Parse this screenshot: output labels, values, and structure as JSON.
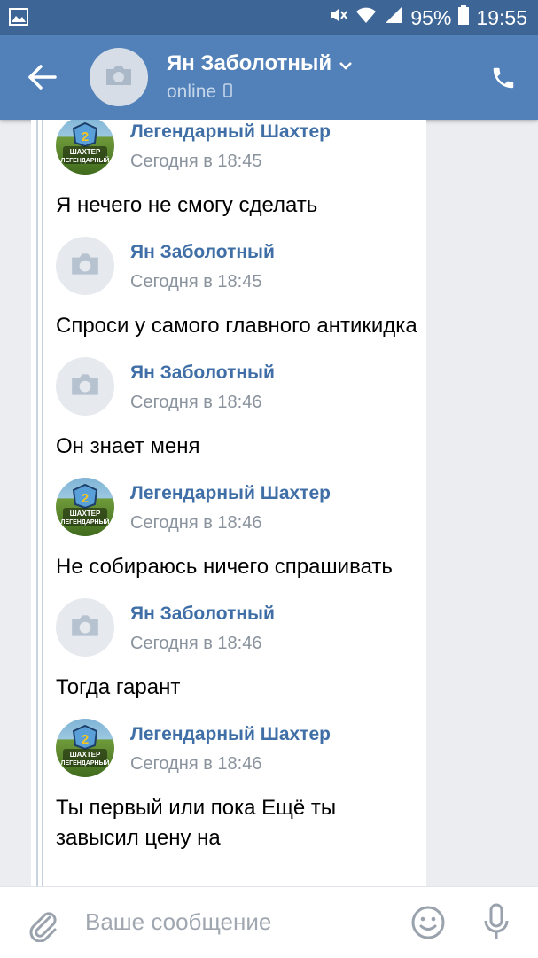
{
  "status_bar": {
    "battery": "95%",
    "time": "19:55"
  },
  "header": {
    "name": "Ян Заболотный",
    "status": "online"
  },
  "messages": [
    {
      "author": "Легендарный Шахтер",
      "time": "Сегодня в 18:45",
      "text": "Я нечего не смогу сделать",
      "avatar": "game-logo"
    },
    {
      "author": "Ян Заболотный",
      "time": "Сегодня в 18:45",
      "text": "Спроси у самого главного антикидка",
      "avatar": "camera-placeholder"
    },
    {
      "author": "Ян Заболотный",
      "time": "Сегодня в 18:46",
      "text": "Он знает меня",
      "avatar": "camera-placeholder"
    },
    {
      "author": "Легендарный Шахтер",
      "time": "Сегодня в 18:46",
      "text": "Не собираюсь ничего спрашивать",
      "avatar": "game-logo"
    },
    {
      "author": "Ян Заболотный",
      "time": "Сегодня в 18:46",
      "text": "Тогда гарант",
      "avatar": "camera-placeholder"
    },
    {
      "author": "Легендарный Шахтер",
      "time": "Сегодня в 18:46",
      "text": "Ты первый или пока Ещё ты завысил цену на",
      "avatar": "game-logo"
    }
  ],
  "game_logo_text": {
    "line1": "ШАХТЕР",
    "line2": "ЛЕГЕНДАРНЫЙ"
  },
  "composer": {
    "placeholder": "Ваше сообщение"
  },
  "colors": {
    "header": "#5181b8",
    "status_bar": "#3d6595",
    "author": "#3f6fa6"
  }
}
